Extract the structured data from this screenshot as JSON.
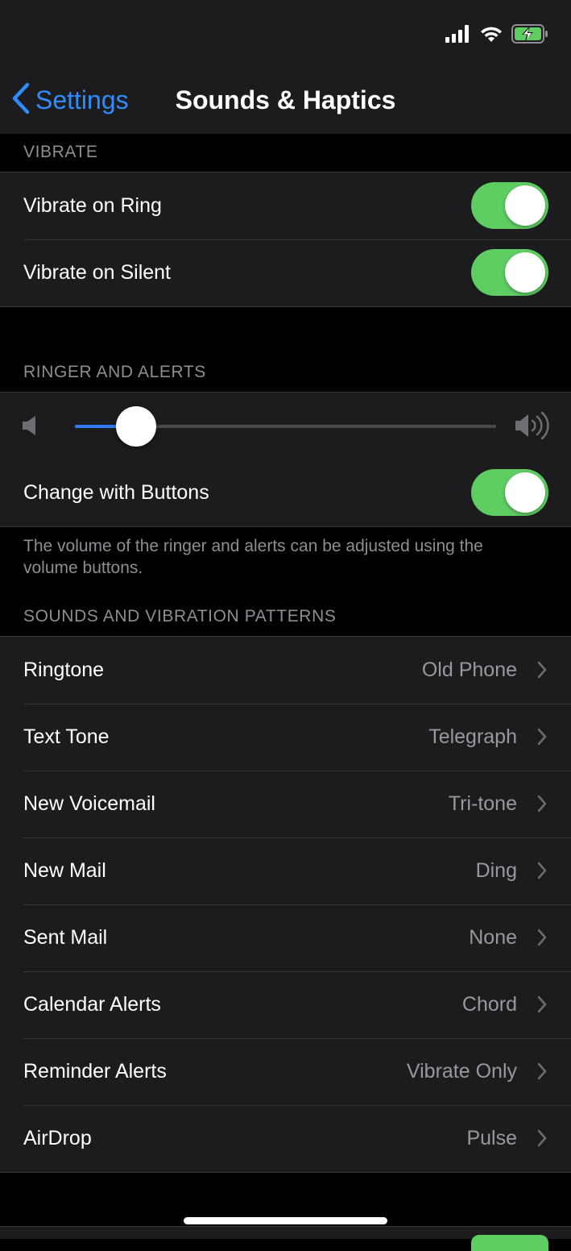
{
  "status_bar": {
    "signal_icon": "cellular-signal-icon",
    "wifi_icon": "wifi-icon",
    "battery_icon": "battery-charging-icon",
    "battery_color": "#5ecd62"
  },
  "nav": {
    "back_label": "Settings",
    "title": "Sounds & Haptics",
    "accent_color": "#2f8cff"
  },
  "vibrate": {
    "header": "VIBRATE",
    "rows": [
      {
        "label": "Vibrate on Ring",
        "on": true
      },
      {
        "label": "Vibrate on Silent",
        "on": true
      }
    ]
  },
  "ringer": {
    "header": "RINGER AND ALERTS",
    "volume_level": 0.145,
    "min_icon": "speaker-low-icon",
    "max_icon": "speaker-high-icon",
    "change_with_buttons": {
      "label": "Change with Buttons",
      "on": true
    },
    "footer": "The volume of the ringer and alerts can be adjusted using the volume buttons."
  },
  "sounds": {
    "header": "SOUNDS AND VIBRATION PATTERNS",
    "rows": [
      {
        "label": "Ringtone",
        "value": "Old Phone"
      },
      {
        "label": "Text Tone",
        "value": "Telegraph"
      },
      {
        "label": "New Voicemail",
        "value": "Tri-tone"
      },
      {
        "label": "New Mail",
        "value": "Ding"
      },
      {
        "label": "Sent Mail",
        "value": "None"
      },
      {
        "label": "Calendar Alerts",
        "value": "Chord"
      },
      {
        "label": "Reminder Alerts",
        "value": "Vibrate Only"
      },
      {
        "label": "AirDrop",
        "value": "Pulse"
      }
    ]
  },
  "colors": {
    "toggle_on": "#5ecd62",
    "slider_fill": "#2f7cf6"
  }
}
